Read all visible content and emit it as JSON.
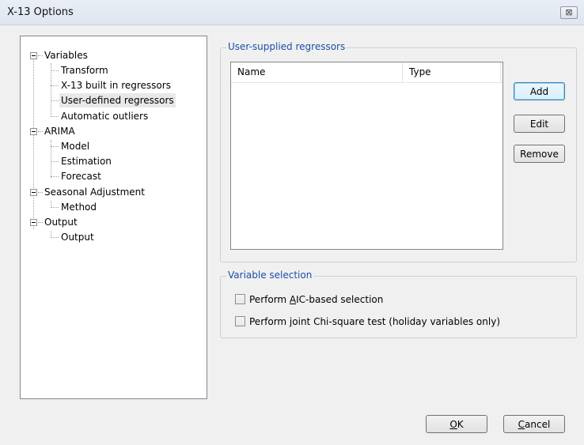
{
  "window": {
    "title": "X-13 Options",
    "close_glyph": "⊠"
  },
  "tree": {
    "variables": {
      "label": "Variables",
      "children": [
        "Transform",
        "X-13 built in regressors",
        "User-defined regressors",
        "Automatic outliers"
      ]
    },
    "arima": {
      "label": "ARIMA",
      "children": [
        "Model",
        "Estimation",
        "Forecast"
      ]
    },
    "seasonal": {
      "label": "Seasonal Adjustment",
      "children": [
        "Method"
      ]
    },
    "output": {
      "label": "Output",
      "children": [
        "Output"
      ]
    },
    "selected": "User-defined regressors"
  },
  "regressors_group": {
    "legend": "User-supplied regressors",
    "columns": [
      "Name",
      "Type"
    ],
    "rows": [],
    "add_label": "Add",
    "edit_label": "Edit",
    "remove_label": "Remove"
  },
  "selection_group": {
    "legend": "Variable selection",
    "aic": {
      "pre": "Perform ",
      "accel": "A",
      "post": "IC-based selection",
      "checked": false
    },
    "chi": {
      "pre": "Perform ",
      "accel": "j",
      "post": "oint Chi-square test (holiday variables only)",
      "checked": false
    }
  },
  "footer": {
    "ok": {
      "accel": "O",
      "rest": "K"
    },
    "cancel": {
      "accel": "C",
      "rest": "ancel"
    }
  }
}
